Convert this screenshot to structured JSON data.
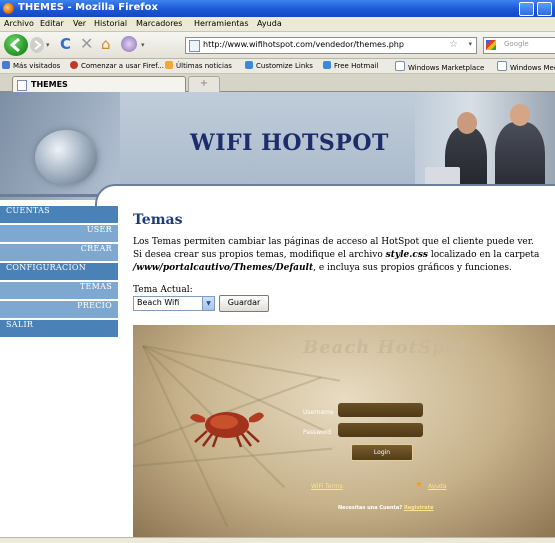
{
  "window": {
    "title": "THEMES - Mozilla Firefox"
  },
  "menubar": [
    "Archivo",
    "Editar",
    "Ver",
    "Historial",
    "Marcadores",
    "Herramientas",
    "Ayuda"
  ],
  "navbar": {
    "url": "http://www.wifihotspot.com/vendedor/themes.php",
    "search_placeholder": "Google"
  },
  "bookmarks": [
    "Más visitados",
    "Comenzar a usar Firef...",
    "Últimas noticias",
    "Customize Links",
    "Free Hotmail",
    "Windows Marketplace",
    "Windows Media"
  ],
  "tabs": [
    {
      "label": "THEMES"
    },
    {
      "label": "+"
    }
  ],
  "banner": {
    "title": "WIFI HOTSPOT"
  },
  "sidebar": [
    {
      "label": "CUENTAS",
      "level": "main"
    },
    {
      "label": "USER",
      "level": "sub"
    },
    {
      "label": "CREAR",
      "level": "sub"
    },
    {
      "label": "CONFIGURACIÓN",
      "level": "main"
    },
    {
      "label": "TEMAS",
      "level": "sub"
    },
    {
      "label": "PRECIO",
      "level": "sub"
    },
    {
      "label": "SALIR",
      "level": "main"
    }
  ],
  "main": {
    "heading": "Temas",
    "desc_part1": "Los Temas permiten cambiar las páginas de acceso al HotSpot que el cliente puede ver. Si desea crear sus propios temas, modifique el archivo ",
    "desc_file": "style.css",
    "desc_part2": " localizado en la carpeta ",
    "desc_path": "/www/portalcautivo/Themes/Default",
    "desc_part3": ", e incluya sus propios gráficos y funciones.",
    "current_label": "Tema Actual:",
    "select_value": "Beach Wifi",
    "save_button": "Guardar"
  },
  "preview": {
    "title": "Beach HotSpot",
    "username_label": "Username",
    "password_label": "Password",
    "login_button": "Login",
    "wifi_link": "WiFi Terms",
    "help_link": "Ayuda",
    "account_text": "Necesitas una Cuenta?",
    "register_link": "Registrate"
  },
  "colors": {
    "sidebar_main": "#4a82b8",
    "sidebar_sub": "#7fa8d0",
    "heading": "#1d3a7a",
    "banner_title": "#1d2d6b"
  }
}
